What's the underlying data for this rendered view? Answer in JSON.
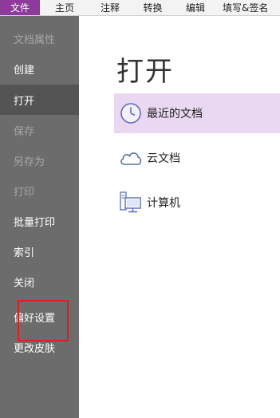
{
  "ribbon": {
    "tabs": [
      "文件",
      "主页",
      "注释",
      "转换",
      "编辑",
      "填写&签名"
    ]
  },
  "sidebar": {
    "items": [
      {
        "label": "文档属性",
        "state": "disabled"
      },
      {
        "label": "创建",
        "state": "normal"
      },
      {
        "label": "打开",
        "state": "active"
      },
      {
        "label": "保存",
        "state": "disabled"
      },
      {
        "label": "另存为",
        "state": "disabled"
      },
      {
        "label": "打印",
        "state": "disabled"
      },
      {
        "label": "批量打印",
        "state": "normal"
      },
      {
        "label": "索引",
        "state": "normal"
      },
      {
        "label": "关闭",
        "state": "normal"
      },
      {
        "label": "偏好设置",
        "state": "normal"
      },
      {
        "label": "更改皮肤",
        "state": "normal"
      }
    ]
  },
  "main": {
    "title": "打开",
    "options": [
      {
        "label": "最近的文档",
        "icon": "clock-icon",
        "selected": true
      },
      {
        "label": "云文档",
        "icon": "cloud-icon",
        "selected": false
      },
      {
        "label": "计算机",
        "icon": "computer-icon",
        "selected": false
      }
    ]
  },
  "colors": {
    "accent": "#8d3a9c",
    "sidebar_bg": "#6c6c6c",
    "sidebar_active": "#545454",
    "selected_bg": "#ead7f1",
    "annotation_box": "#e01e1e"
  }
}
